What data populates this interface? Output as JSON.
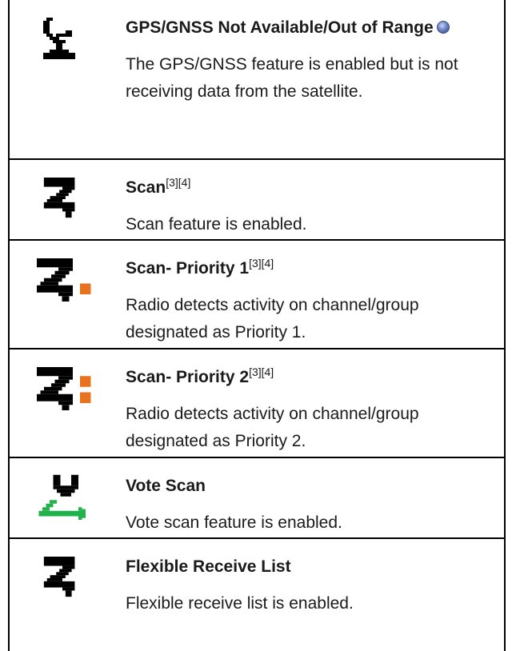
{
  "rows": [
    {
      "icon": "gps-not-available-icon",
      "title": "GPS/GNSS Not Available/Out of Range",
      "globe_icon": "globe-icon",
      "description": "The GPS/GNSS feature is enabled but is not receiving data from the satellite."
    },
    {
      "icon": "scan-icon",
      "title": "Scan",
      "superscript": "[3][4]",
      "description": "Scan feature is enabled."
    },
    {
      "icon": "scan-priority-1-icon",
      "title": "Scan- Priority 1",
      "superscript": "[3][4]",
      "description": "Radio detects activity on channel/group designated as Priority 1."
    },
    {
      "icon": "scan-priority-2-icon",
      "title": "Scan- Priority 2",
      "superscript": "[3][4]",
      "description": "Radio detects activity on channel/group designated as Priority 2."
    },
    {
      "icon": "vote-scan-icon",
      "title": "Vote Scan",
      "description": "Vote scan feature is enabled."
    },
    {
      "icon": "flexible-receive-list-icon",
      "title": "Flexible Receive List",
      "description": "Flexible receive list is enabled."
    }
  ],
  "colors": {
    "priority_accent": "#e8731e",
    "vote_accent": "#22b24c",
    "icon_black": "#000000",
    "text": "#1a1a1a",
    "border": "#000000"
  }
}
